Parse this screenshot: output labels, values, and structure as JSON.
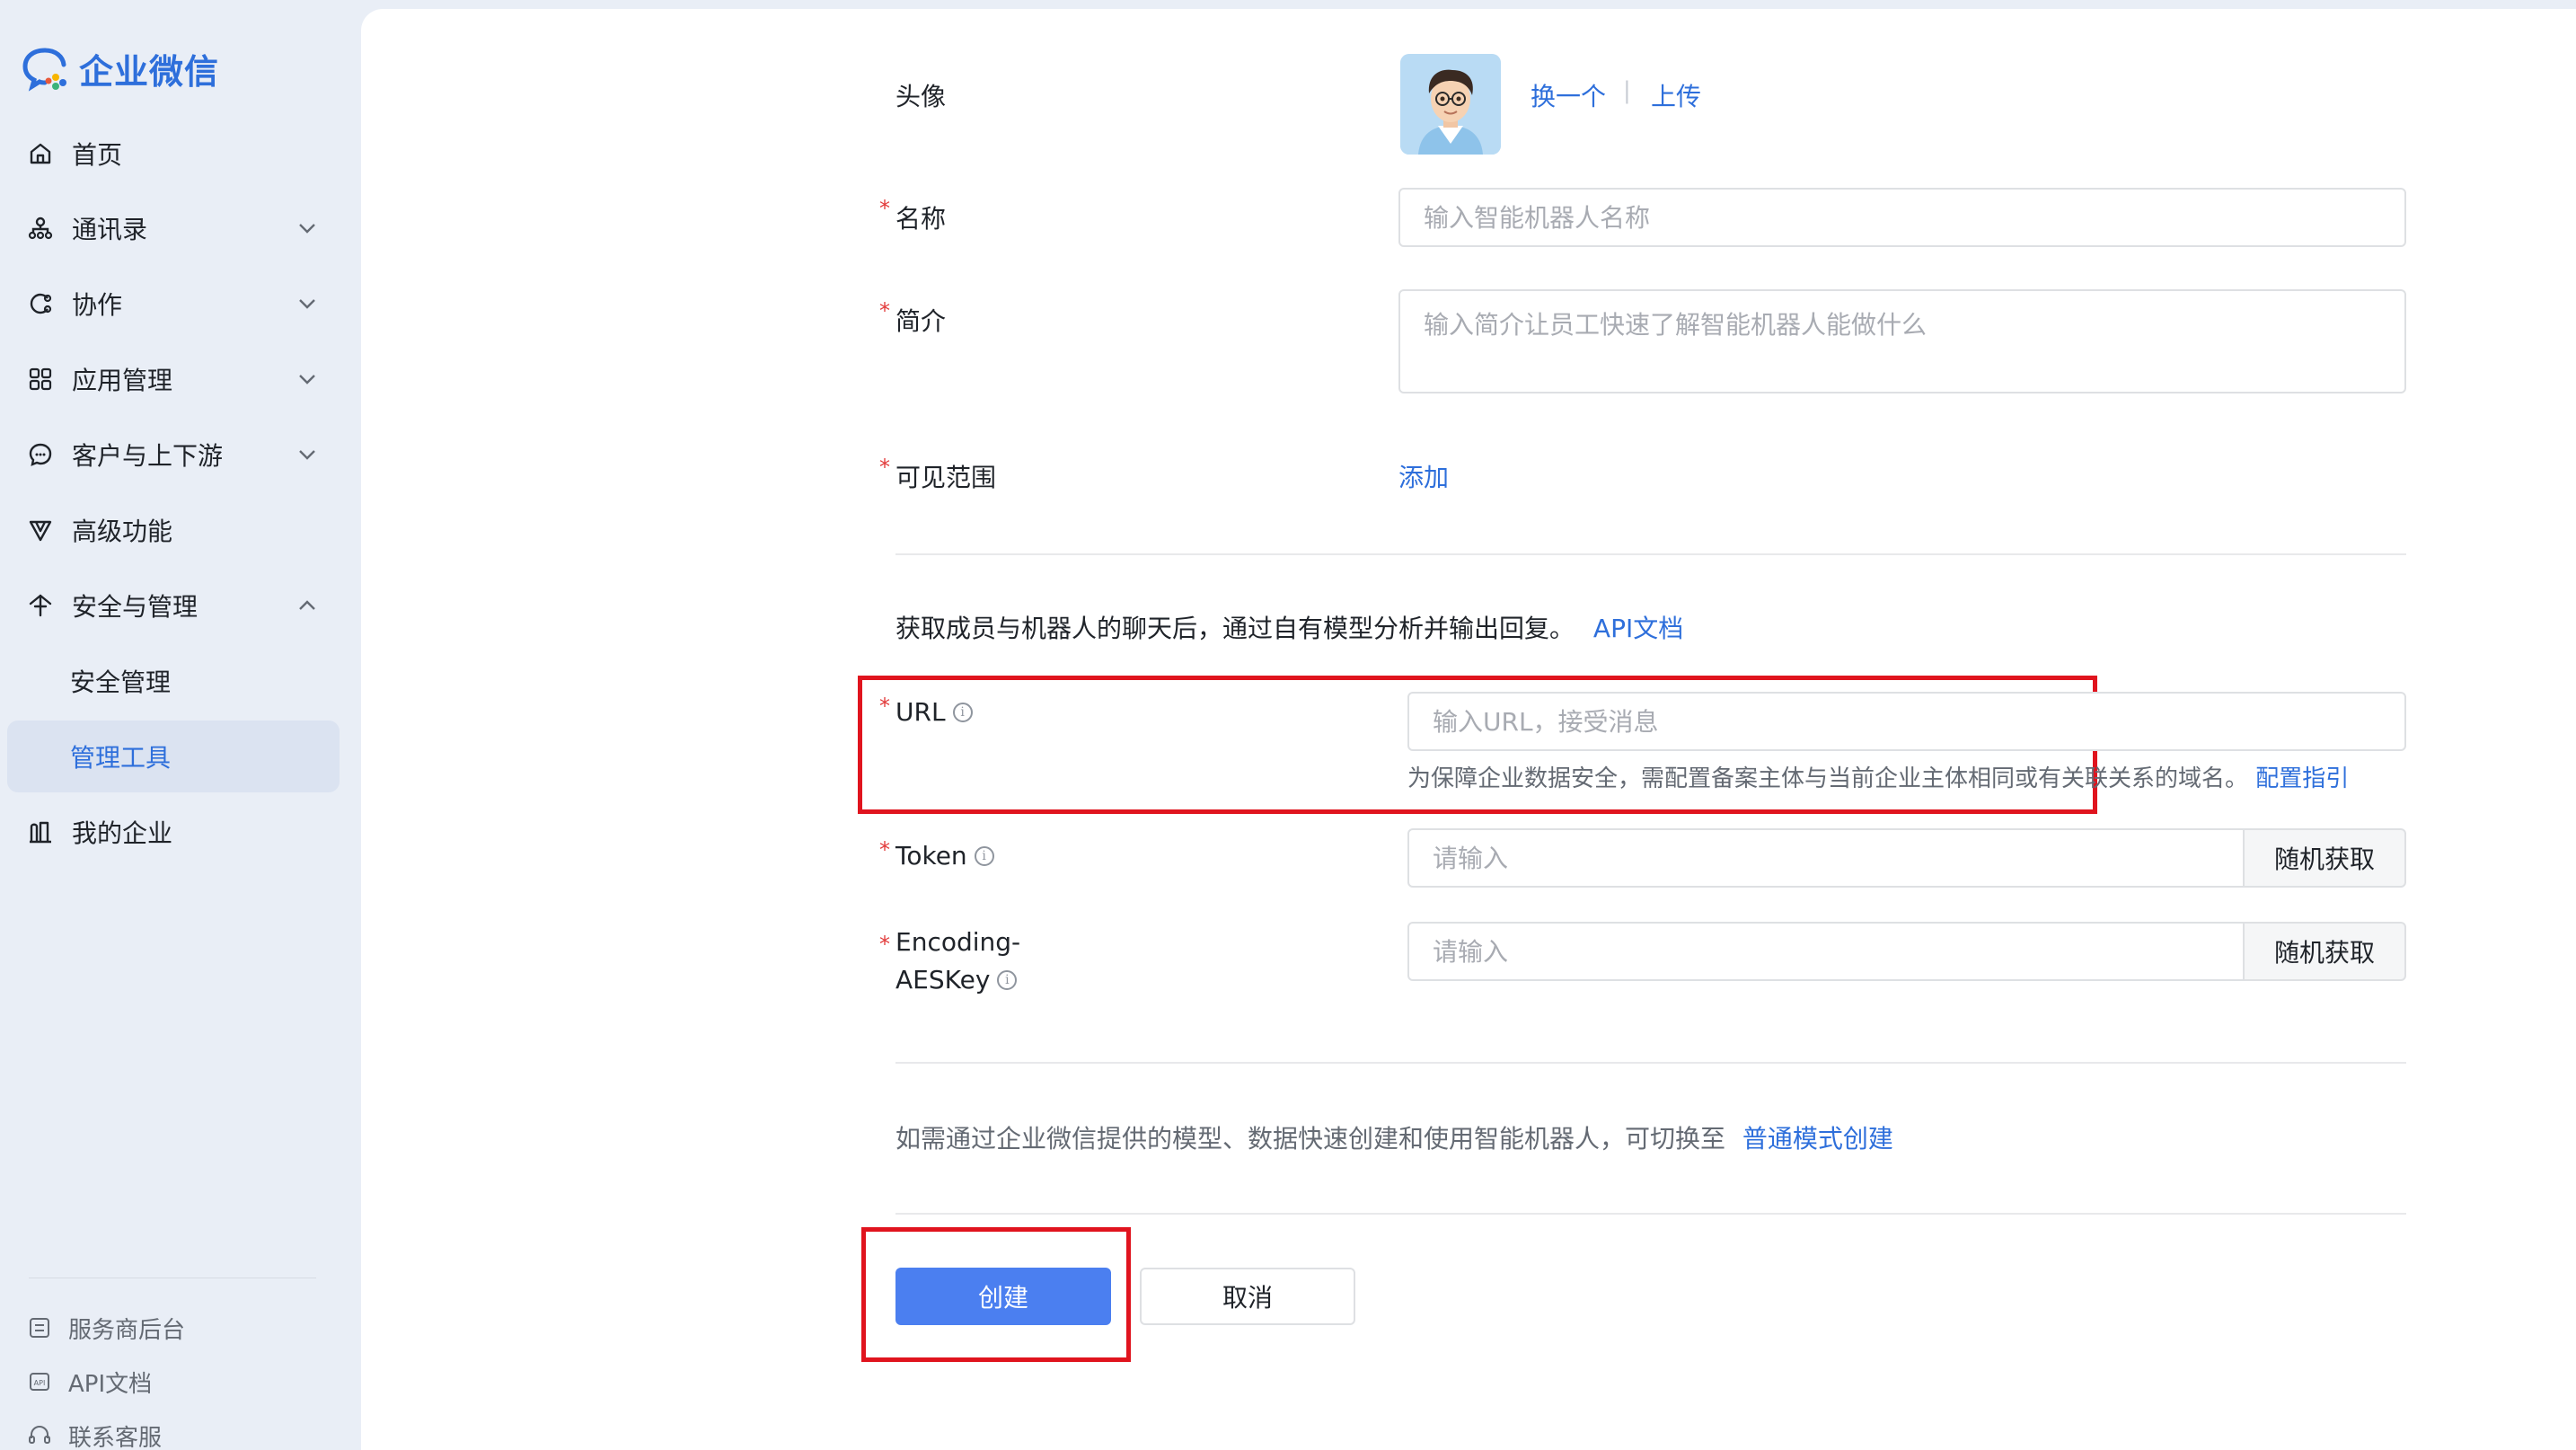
{
  "app": {
    "title": "企业微信",
    "brand_color": "#2e6fdb"
  },
  "sidebar": {
    "items": [
      {
        "label": "首页",
        "icon": "home-icon"
      },
      {
        "label": "通讯录",
        "icon": "org-chart-icon"
      },
      {
        "label": "协作",
        "icon": "collaborate-icon"
      },
      {
        "label": "应用管理",
        "icon": "apps-grid-icon"
      },
      {
        "label": "客户与上下游",
        "icon": "chat-bubble-icon"
      },
      {
        "label": "高级功能",
        "icon": "advanced-v-icon"
      },
      {
        "label": "安全与管理",
        "icon": "shield-icon"
      },
      {
        "label": "安全管理"
      },
      {
        "label": "管理工具"
      },
      {
        "label": "我的企业",
        "icon": "buildings-icon"
      }
    ],
    "footer": [
      {
        "label": "服务商后台",
        "icon": "panel-icon"
      },
      {
        "label": "API文档",
        "icon": "api-doc-icon"
      },
      {
        "label": "联系客服",
        "icon": "headset-icon"
      }
    ]
  },
  "form": {
    "avatar": {
      "label": "头像",
      "change_link": "换一个",
      "separator": "|",
      "upload_link": "上传"
    },
    "name": {
      "label": "名称",
      "placeholder": "输入智能机器人名称"
    },
    "intro": {
      "label": "简介",
      "placeholder": "输入简介让员工快速了解智能机器人能做什么"
    },
    "scope": {
      "label": "可见范围",
      "add_link": "添加"
    },
    "api_desc": "获取成员与机器人的聊天后，通过自有模型分析并输出回复。",
    "api_doc_link": "API文档",
    "url": {
      "label": "URL",
      "placeholder": "输入URL，接受消息",
      "hint": "为保障企业数据安全，需配置备案主体与当前企业主体相同或有关联关系的域名。",
      "hint_link": "配置指引"
    },
    "token": {
      "label": "Token",
      "placeholder": "请输入",
      "button": "随机获取"
    },
    "aeskey": {
      "label_line1": "Encoding-",
      "label_line2": "AESKey",
      "placeholder": "请输入",
      "button": "随机获取"
    },
    "switch_text": "如需通过企业微信提供的模型、数据快速创建和使用智能机器人，可切换至",
    "switch_link": "普通模式创建",
    "required_mark": "*",
    "create_button": "创建",
    "cancel_button": "取消"
  },
  "colors": {
    "link": "#2e6fdb",
    "primary_button": "#4b7ff0",
    "highlight_box": "#e0141e",
    "required": "#e23b3b"
  }
}
